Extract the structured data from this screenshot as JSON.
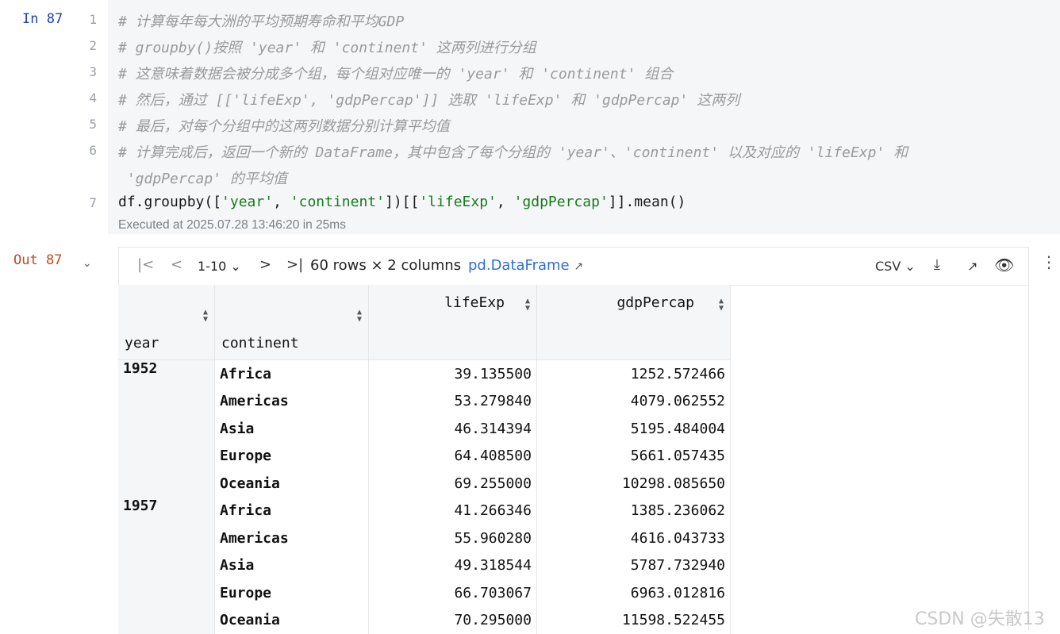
{
  "input_cell": {
    "label": "In 87",
    "lines": [
      {
        "num": "1",
        "text": "# 计算每年每大洲的平均预期寿命和平均GDP"
      },
      {
        "num": "2",
        "text": "# groupby()按照 'year' 和 'continent' 这两列进行分组"
      },
      {
        "num": "3",
        "text": "# 这意味着数据会被分成多个组，每个组对应唯一的 'year' 和 'continent' 组合"
      },
      {
        "num": "4",
        "text": "# 然后，通过 [['lifeExp', 'gdpPercap']] 选取 'lifeExp' 和 'gdpPercap' 这两列"
      },
      {
        "num": "5",
        "text": "# 最后，对每个分组中的这两列数据分别计算平均值"
      },
      {
        "num": "6",
        "text": "# 计算完成后，返回一个新的 DataFrame，其中包含了每个分组的 'year'、'continent' 以及对应的 'lifeExp' 和"
      },
      {
        "num": "",
        "text": " 'gdpPercap' 的平均值"
      },
      {
        "num": "7",
        "code": {
          "p1": "df.groupby([",
          "s1": "'year'",
          "p2": ", ",
          "s2": "'continent'",
          "p3": "])[[",
          "s3": "'lifeExp'",
          "p4": ", ",
          "s4": "'gdpPercap'",
          "p5": "]].mean()"
        }
      }
    ],
    "executed": "Executed at 2025.07.28 13:46:20 in 25ms"
  },
  "output_cell": {
    "label": "Out 87",
    "toolbar": {
      "page_range": "1-10",
      "shape": "60 rows × 2 columns",
      "type_link": "pd.DataFrame",
      "export_format": "CSV"
    },
    "table": {
      "index_headers": [
        "year",
        "continent"
      ],
      "columns": [
        "lifeExp",
        "gdpPercap"
      ],
      "groups": [
        {
          "year": "1952",
          "rows": [
            {
              "continent": "Africa",
              "lifeExp": "39.135500",
              "gdpPercap": "1252.572466"
            },
            {
              "continent": "Americas",
              "lifeExp": "53.279840",
              "gdpPercap": "4079.062552"
            },
            {
              "continent": "Asia",
              "lifeExp": "46.314394",
              "gdpPercap": "5195.484004"
            },
            {
              "continent": "Europe",
              "lifeExp": "64.408500",
              "gdpPercap": "5661.057435"
            },
            {
              "continent": "Oceania",
              "lifeExp": "69.255000",
              "gdpPercap": "10298.085650"
            }
          ]
        },
        {
          "year": "1957",
          "rows": [
            {
              "continent": "Africa",
              "lifeExp": "41.266346",
              "gdpPercap": "1385.236062"
            },
            {
              "continent": "Americas",
              "lifeExp": "55.960280",
              "gdpPercap": "4616.043733"
            },
            {
              "continent": "Asia",
              "lifeExp": "49.318544",
              "gdpPercap": "5787.732940"
            },
            {
              "continent": "Europe",
              "lifeExp": "66.703067",
              "gdpPercap": "6963.012816"
            },
            {
              "continent": "Oceania",
              "lifeExp": "70.295000",
              "gdpPercap": "11598.522455"
            }
          ]
        }
      ]
    }
  },
  "watermark": "CSDN @失散13",
  "icons": [
    "first-page-icon",
    "prev-page-icon",
    "chevron-down-icon",
    "next-page-icon",
    "last-page-icon",
    "external-link-icon",
    "download-icon",
    "open-icon",
    "eye-icon",
    "more-vertical-icon",
    "sort-icon",
    "collapse-chevron-icon"
  ]
}
